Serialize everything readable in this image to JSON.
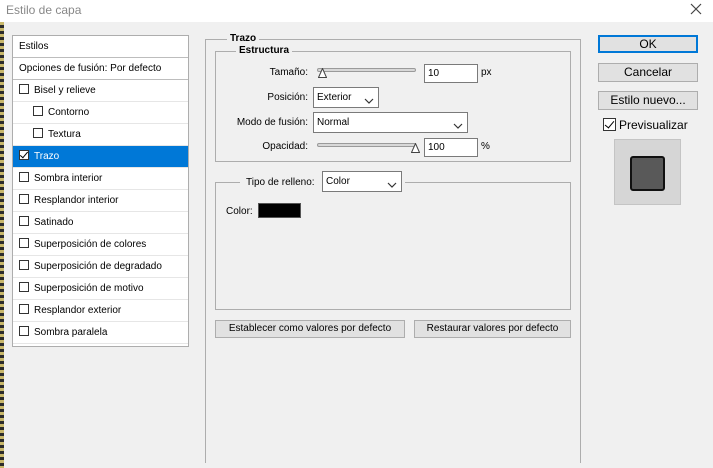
{
  "window": {
    "title": "Estilo de capa"
  },
  "left_list": {
    "header": "Estilos",
    "blend_options": "Opciones de fusión: Por defecto",
    "items": [
      {
        "label": "Bisel y relieve",
        "checked": false,
        "sub": false,
        "selected": false
      },
      {
        "label": "Contorno",
        "checked": false,
        "sub": true,
        "selected": false
      },
      {
        "label": "Textura",
        "checked": false,
        "sub": true,
        "selected": false
      },
      {
        "label": "Trazo",
        "checked": true,
        "sub": false,
        "selected": true
      },
      {
        "label": "Sombra interior",
        "checked": false,
        "sub": false,
        "selected": false
      },
      {
        "label": "Resplandor interior",
        "checked": false,
        "sub": false,
        "selected": false
      },
      {
        "label": "Satinado",
        "checked": false,
        "sub": false,
        "selected": false
      },
      {
        "label": "Superposición de colores",
        "checked": false,
        "sub": false,
        "selected": false
      },
      {
        "label": "Superposición de degradado",
        "checked": false,
        "sub": false,
        "selected": false
      },
      {
        "label": "Superposición de motivo",
        "checked": false,
        "sub": false,
        "selected": false
      },
      {
        "label": "Resplandor exterior",
        "checked": false,
        "sub": false,
        "selected": false
      },
      {
        "label": "Sombra paralela",
        "checked": false,
        "sub": false,
        "selected": false
      }
    ]
  },
  "panel": {
    "title": "Trazo",
    "structure": {
      "title": "Estructura",
      "size_label": "Tamaño:",
      "size_value": "10",
      "size_unit": "px",
      "size_slider_fraction": 0.05,
      "position_label": "Posición:",
      "position_value": "Exterior",
      "blend_label": "Modo de fusión:",
      "blend_value": "Normal",
      "opacity_label": "Opacidad:",
      "opacity_value": "100",
      "opacity_unit": "%",
      "opacity_slider_fraction": 1.0
    },
    "fill": {
      "type_label": "Tipo de relleno:",
      "type_value": "Color",
      "color_label": "Color:",
      "color_value": "#000000"
    },
    "set_default_button": "Establecer como valores por defecto",
    "reset_default_button": "Restaurar valores por defecto"
  },
  "right": {
    "ok_button": "OK",
    "cancel_button": "Cancelar",
    "new_style_button": "Estilo nuevo...",
    "preview_label": "Previsualizar",
    "preview_checked": true
  },
  "colors": {
    "selection": "#0078d7",
    "background": "#f0f0f0",
    "preview_fill": "#595959"
  }
}
